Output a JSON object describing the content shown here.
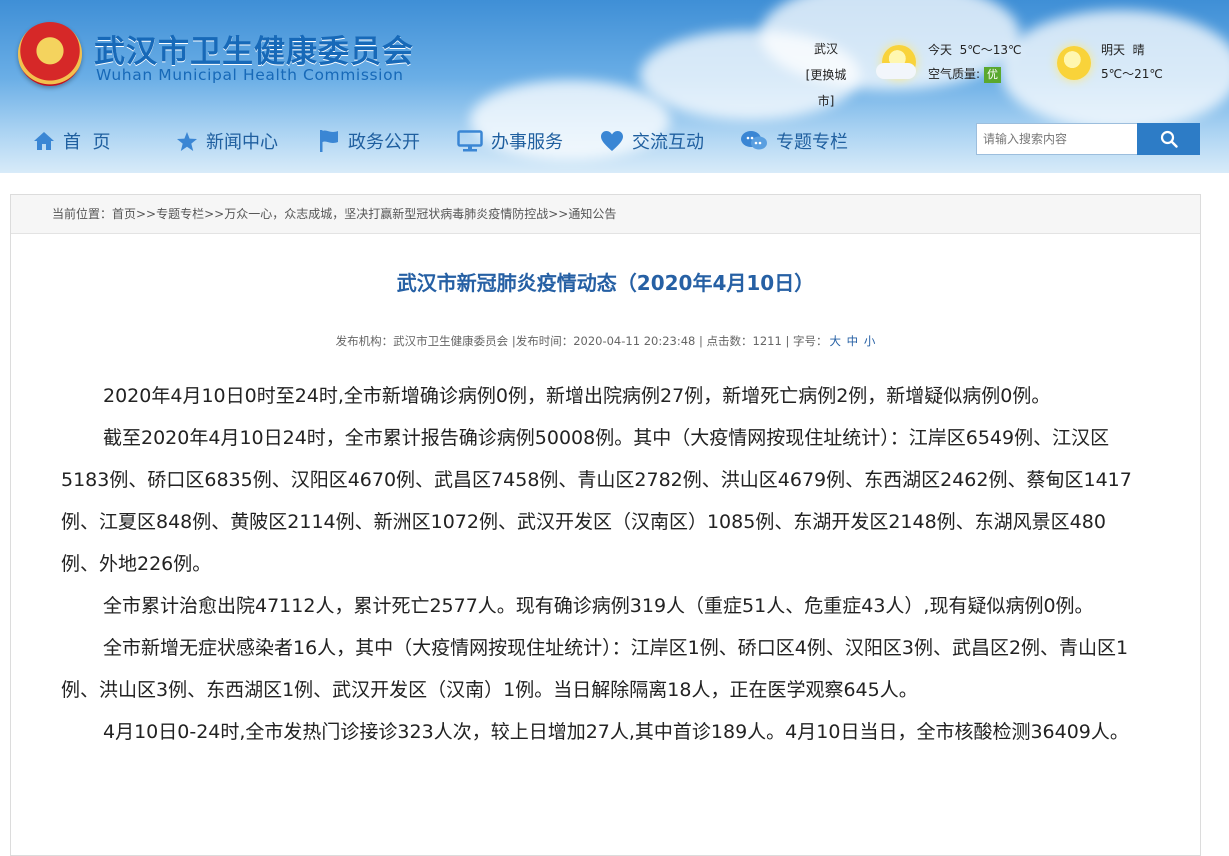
{
  "header": {
    "title_cn": "武汉市卫生健康委员会",
    "title_en": "Wuhan Municipal Health Commission",
    "city": "武汉",
    "change_city": "[更换城市]",
    "today_label": "今天",
    "today_temp": "5℃～13℃",
    "air_label": "空气质量:",
    "air_value": "优",
    "tomorrow_label": "明天",
    "tomorrow_weather": "晴",
    "tomorrow_temp": "5℃～21℃",
    "icons": {
      "today": "sun-cloud-icon",
      "tomorrow": "sun-icon",
      "logo": "national-emblem-icon"
    }
  },
  "nav": [
    {
      "label": "首  页",
      "icon": "home-icon"
    },
    {
      "label": "新闻中心",
      "icon": "star-icon"
    },
    {
      "label": "政务公开",
      "icon": "flag-icon"
    },
    {
      "label": "办事服务",
      "icon": "monitor-icon"
    },
    {
      "label": "交流互动",
      "icon": "heart-icon"
    },
    {
      "label": "专题专栏",
      "icon": "chat-icon"
    }
  ],
  "search": {
    "placeholder": "请输入搜索内容",
    "icon": "search-icon"
  },
  "breadcrumb": "当前位置：首页>>专题专栏>>万众一心，众志成城，坚决打赢新型冠状病毒肺炎疫情防控战>>通知公告",
  "article": {
    "title": "武汉市新冠肺炎疫情动态（2020年4月10日）",
    "meta": {
      "publisher_label": "发布机构：",
      "publisher": "武汉市卫生健康委员会",
      "time_label": "|发布时间：",
      "time": "2020-04-11 20:23:48",
      "clicks_label": "| 点击数：",
      "clicks": "1211",
      "fontsize_label": "| 字号：",
      "size_large": "大",
      "size_medium": "中",
      "size_small": "小"
    },
    "paragraphs": [
      "2020年4月10日0时至24时,全市新增确诊病例0例，新增出院病例27例，新增死亡病例2例，新增疑似病例0例。",
      "截至2020年4月10日24时，全市累计报告确诊病例50008例。其中（大疫情网按现住址统计）：江岸区6549例、江汉区5183例、硚口区6835例、汉阳区4670例、武昌区7458例、青山区2782例、洪山区4679例、东西湖区2462例、蔡甸区1417例、江夏区848例、黄陂区2114例、新洲区1072例、武汉开发区（汉南区）1085例、东湖开发区2148例、东湖风景区480例、外地226例。",
      "全市累计治愈出院47112人，累计死亡2577人。现有确诊病例319人（重症51人、危重症43人）,现有疑似病例0例。",
      "全市新增无症状感染者16人，其中（大疫情网按现住址统计）：江岸区1例、硚口区4例、汉阳区3例、武昌区2例、青山区1例、洪山区3例、东西湖区1例、武汉开发区（汉南）1例。当日解除隔离18人，正在医学观察645人。",
      "4月10日0-24时,全市发热门诊接诊323人次，较上日增加27人,其中首诊189人。4月10日当日，全市核酸检测36409人。"
    ]
  }
}
